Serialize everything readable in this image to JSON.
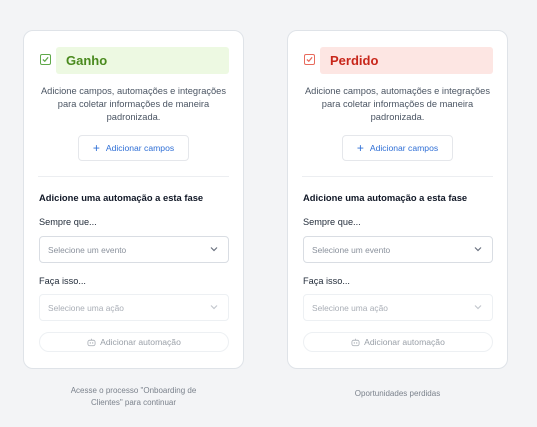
{
  "stages": [
    {
      "title": "Ganho",
      "description": "Adicione campos, automações e integrações para coletar informações de maneira padronizada.",
      "add_fields_label": "Adicionar campos",
      "automation_section_title": "Adicione uma automação a esta fase",
      "when_label": "Sempre que...",
      "event_placeholder": "Selecione um evento",
      "do_label": "Faça isso...",
      "action_placeholder": "Selecione uma ação",
      "add_automation_label": "Adicionar automação",
      "footer_text": "Acesse o processo \"Onboarding de Clientes\" para continuar"
    },
    {
      "title": "Perdido",
      "description": "Adicione campos, automações e integrações para coletar informações de maneira padronizada.",
      "add_fields_label": "Adicionar campos",
      "automation_section_title": "Adicione uma automação a esta fase",
      "when_label": "Sempre que...",
      "event_placeholder": "Selecione um evento",
      "do_label": "Faça isso...",
      "action_placeholder": "Selecione uma ação",
      "add_automation_label": "Adicionar automação",
      "footer_text": "Oportunidades perdidas"
    }
  ],
  "icons": {
    "stage_icon": "checkbox-icon",
    "add_fields_icon": "plus-icon",
    "select_icon": "chevron-down-icon",
    "add_automation_icon": "robot-icon"
  },
  "colors": {
    "won_accent": "#4a8a1e",
    "won_bg": "#edf9e2",
    "lost_accent": "#c8261a",
    "lost_bg": "#fde6e3",
    "link_blue": "#2f6fd6"
  }
}
